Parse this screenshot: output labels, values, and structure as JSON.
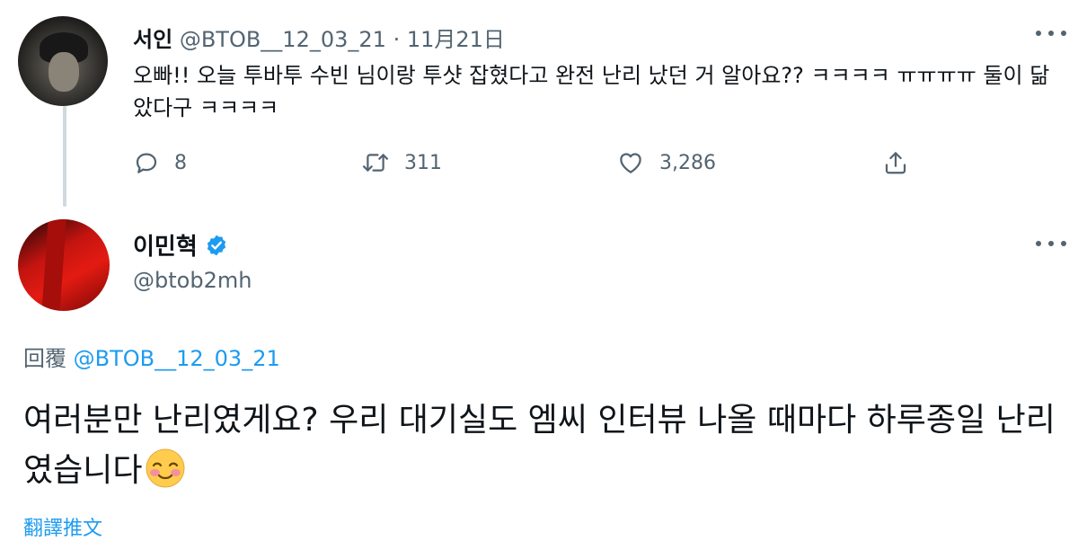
{
  "parent_tweet": {
    "display_name": "서인",
    "handle": "@BTOB__12_03_21",
    "separator": "·",
    "date": "11月21日",
    "text": "오빠!! 오늘 투바투 수빈 님이랑 투샷 잡혔다고 완전 난리 났던 거 알아요?? ㅋㅋㅋㅋ ㅠㅠㅠㅠ 둘이 닮았다구 ㅋㅋㅋㅋ",
    "actions": {
      "reply_count": "8",
      "retweet_count": "311",
      "like_count": "3,286"
    }
  },
  "reply_tweet": {
    "display_name": "이민혁",
    "handle": "@btob2mh",
    "verified": true,
    "reply_label": "回覆",
    "reply_to_handle": "@BTOB__12_03_21",
    "text": "여러분만 난리였게요? 우리 대기실도 엠씨 인터뷰 나올 때마다 하루종일 난리였습니다",
    "translate_label": "翻譯推文"
  },
  "colors": {
    "text_primary": "#0f1419",
    "text_secondary": "#536471",
    "accent": "#1d9bf0",
    "thread_line": "#cfd9de"
  },
  "icons": [
    "more-icon",
    "reply-icon",
    "retweet-icon",
    "like-icon",
    "share-icon",
    "verified-icon",
    "smiling-face-emoji"
  ]
}
